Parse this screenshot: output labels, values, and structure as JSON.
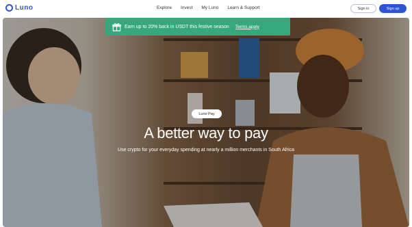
{
  "nav": {
    "logo_text": "Luno",
    "links": [
      "Explore",
      "Invest",
      "My Luno",
      "Learn & Support"
    ],
    "sign_in": "Sign in",
    "sign_up": "Sign up"
  },
  "promo": {
    "text": "Earn up to 20% back in USDT this festive season",
    "link": "Terms apply"
  },
  "hero": {
    "badge": "Luno Pay",
    "headline": "A better way to pay",
    "subline": "Use crypto for your everyday spending at nearly a million merchants in South Africa"
  },
  "colors": {
    "brand": "#2f55d4",
    "promo": "#35a87c"
  }
}
